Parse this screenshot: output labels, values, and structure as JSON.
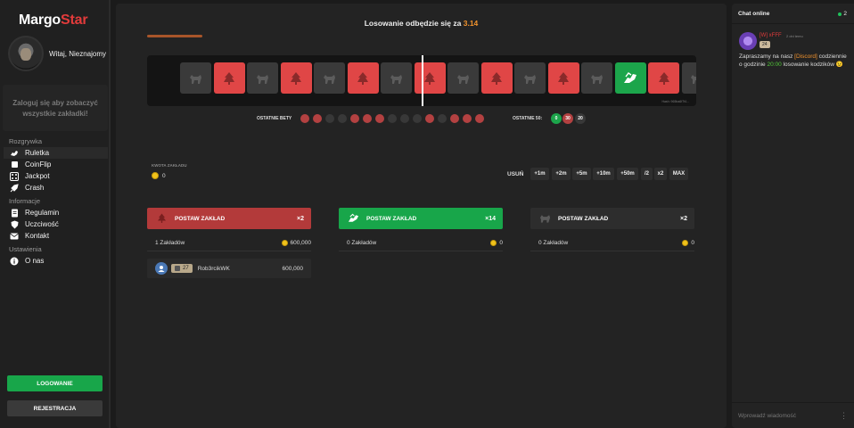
{
  "brand": {
    "part1": "Margo",
    "part2": "Star"
  },
  "user": {
    "greeting": "Witaj, Nieznajomy"
  },
  "sidebar": {
    "login_hint_line1": "Zaloguj się aby zobaczyć",
    "login_hint_line2": "wszystkie zakładki!",
    "sections": [
      {
        "title": "Rozgrywka",
        "items": [
          {
            "label": "Ruletka",
            "icon": "dragon-icon"
          },
          {
            "label": "CoinFlip",
            "icon": "coin-icon"
          },
          {
            "label": "Jackpot",
            "icon": "dice-icon"
          },
          {
            "label": "Crash",
            "icon": "rocket-icon"
          }
        ]
      },
      {
        "title": "Informacje",
        "items": [
          {
            "label": "Regulamin",
            "icon": "document-icon"
          },
          {
            "label": "Uczciwość",
            "icon": "shield-icon"
          },
          {
            "label": "Kontakt",
            "icon": "mail-icon"
          }
        ]
      },
      {
        "title": "Ustawienia",
        "items": [
          {
            "label": "O nas",
            "icon": "info-icon"
          }
        ]
      }
    ],
    "login_button": "LOGOWANIE",
    "register_button": "REJESTRACJA"
  },
  "game": {
    "draw_text": "Losowanie odbędzie się za",
    "countdown": "3.14",
    "progress_fraction": 0.1,
    "tiles": [
      "red-partial",
      "gray",
      "red",
      "gray",
      "red",
      "gray",
      "red",
      "gray",
      "red",
      "gray",
      "red",
      "gray",
      "red",
      "gray",
      "green",
      "red",
      "gray",
      "red-partial"
    ],
    "hash": "Hash: 965ba6f7f4...",
    "last_bets_label": "OSTATNIE BETY",
    "last_bets": [
      "red",
      "red",
      "dark",
      "dark",
      "red",
      "red",
      "red",
      "dark",
      "dark",
      "dark",
      "red",
      "dark",
      "red",
      "red",
      "red"
    ],
    "last_50_label": "OSTATNIE 50:",
    "last_50": {
      "green": "0",
      "red": "30",
      "gray": "20"
    },
    "amount_label": "KWOTA ZAKŁADU",
    "amount_value": "0",
    "remove_label": "USUŃ",
    "modifiers": [
      "+1m",
      "+2m",
      "+5m",
      "+10m",
      "+50m",
      "/2",
      "x2",
      "MAX"
    ]
  },
  "bets": [
    {
      "color": "red",
      "label": "POSTAW ZAKŁAD",
      "multiplier": "×2",
      "count_text": "1 Zakładów",
      "total": "600,000"
    },
    {
      "color": "green",
      "label": "POSTAW ZAKŁAD",
      "multiplier": "×14",
      "count_text": "0 Zakładów",
      "total": "0"
    },
    {
      "color": "gray",
      "label": "POSTAW ZAKŁAD",
      "multiplier": "×2",
      "count_text": "0 Zakładów",
      "total": "0"
    }
  ],
  "players_red": [
    {
      "level": "27",
      "name": "Rob3rcikWK",
      "amount": "600,000"
    }
  ],
  "chat": {
    "title": "Chat online",
    "online_count": "2",
    "message": {
      "user": "[W] xFFF",
      "time": "2 dni temu",
      "badge": "24",
      "text_before": "Zapraszamy na nasz",
      "discord": "[Discord]",
      "text_mid": "codziennie o godzinie",
      "hour": "20:00",
      "text_after": "losowanie kodzików 😉"
    },
    "input_placeholder": "Wprowadź wiadomość"
  },
  "colors": {
    "red": "#e04646",
    "green": "#1ca54b",
    "gray": "#3a3a3a",
    "accent_orange": "#f0922d"
  }
}
